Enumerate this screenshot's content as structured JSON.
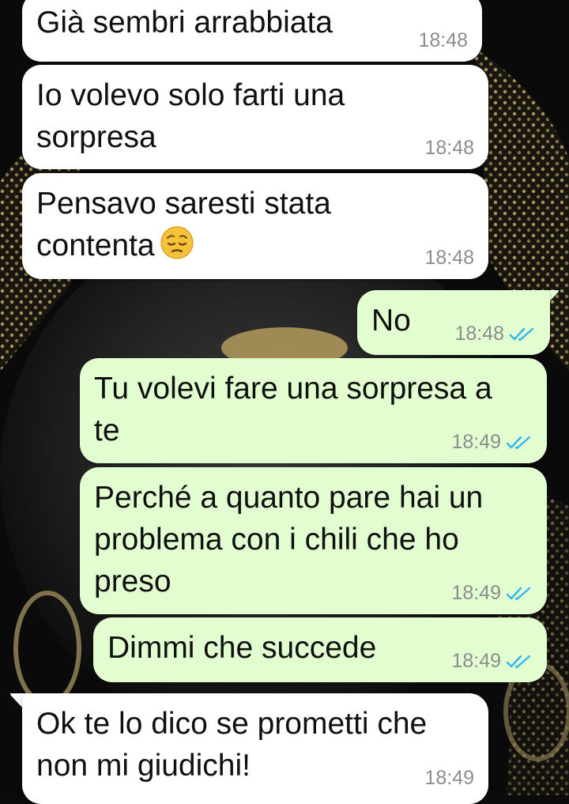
{
  "messages": [
    {
      "text": "Già sembri arrabbiata",
      "time": "18:48",
      "direction": "incoming"
    },
    {
      "text": "Io volevo solo farti una\nsorpresa",
      "time": "18:48",
      "direction": "incoming"
    },
    {
      "text": "Pensavo saresti stata\ncontenta",
      "emoji": "pensive-face",
      "time": "18:48",
      "direction": "incoming"
    },
    {
      "text": "No",
      "time": "18:48",
      "direction": "outgoing",
      "status": "read"
    },
    {
      "text": "Tu volevi fare una sorpresa a\nte",
      "time": "18:49",
      "direction": "outgoing",
      "status": "read"
    },
    {
      "text": "Perché a quanto pare hai un\nproblema con i chili che ho\npreso",
      "time": "18:49",
      "direction": "outgoing",
      "status": "read"
    },
    {
      "text": "Dimmi che succede",
      "time": "18:49",
      "direction": "outgoing",
      "status": "read"
    },
    {
      "text": "Ok te lo dico se prometti che\nnon mi giudichi!",
      "time": "18:49",
      "direction": "incoming"
    }
  ],
  "colors": {
    "incoming_bubble": "#ffffff",
    "outgoing_bubble": "#e2fdd0",
    "read_ticks": "#34b7f1",
    "timestamp": "#8d8d8d"
  }
}
